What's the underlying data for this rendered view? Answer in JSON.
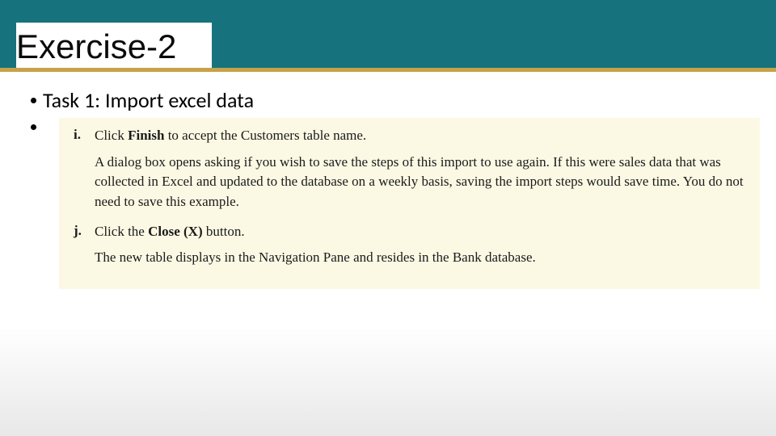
{
  "header": {
    "title": "Exercise-2"
  },
  "content": {
    "task_label": "Task 1: Import excel data",
    "steps": [
      {
        "marker": "i.",
        "action_prefix": "Click ",
        "action_bold": "Finish",
        "action_suffix": " to accept the Customers table name.",
        "sub": "A dialog box opens asking if you wish to save the steps of this import to use again. If this were sales data that was collected in Excel and updated to the database on a weekly basis, saving the import steps would save time. You do not need to save this example."
      },
      {
        "marker": "j.",
        "action_prefix": "Click the ",
        "action_bold": "Close (X)",
        "action_suffix": " button.",
        "sub": "The new table displays in the Navigation Pane and resides in the Bank database."
      }
    ]
  }
}
